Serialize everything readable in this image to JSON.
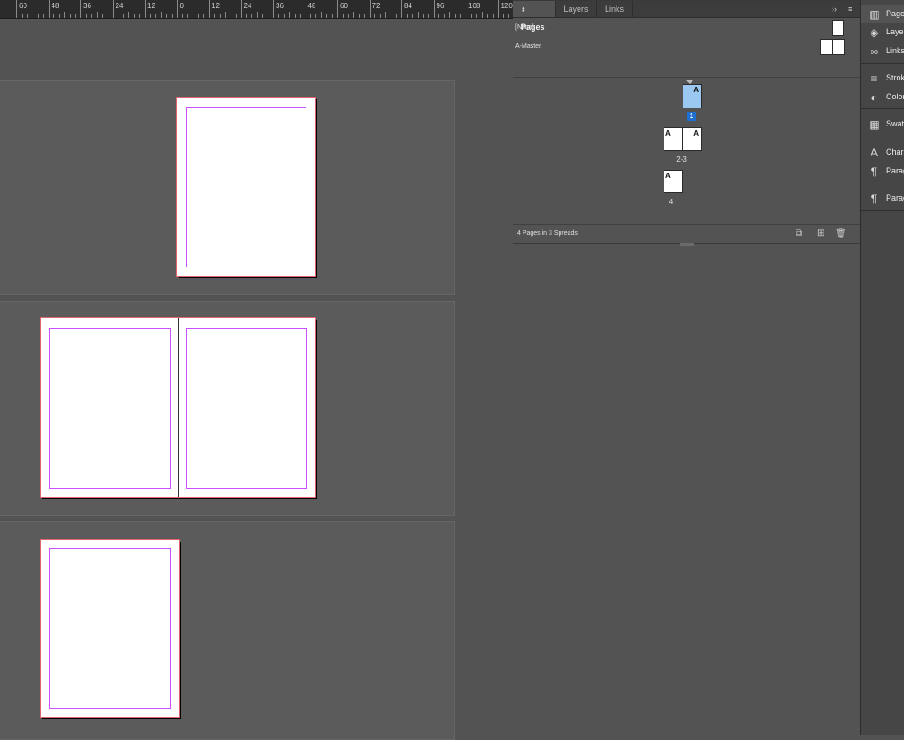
{
  "ruler": {
    "labels": [
      "60",
      "48",
      "36",
      "24",
      "12",
      "0",
      "12",
      "24",
      "36",
      "48",
      "60",
      "72",
      "84",
      "96",
      "108",
      "120"
    ]
  },
  "panel": {
    "tabs": [
      {
        "label": "Pages",
        "active": true
      },
      {
        "label": "Layers",
        "active": false
      },
      {
        "label": "Links",
        "active": false
      }
    ],
    "overflow_label": "››",
    "menu_label": "≡",
    "masters": [
      {
        "label": "[None]"
      },
      {
        "label": "A-Master"
      }
    ],
    "thumbnails": [
      {
        "letters": [
          "A"
        ],
        "number": "1",
        "selected": true
      },
      {
        "letters": [
          "A",
          "A"
        ],
        "number": "2-3",
        "selected": false
      },
      {
        "letters": [
          "A"
        ],
        "number": "4",
        "selected": false
      }
    ],
    "status": "4 Pages in 3 Spreads"
  },
  "dock": {
    "items": [
      {
        "label": "Pages",
        "icon": "pages-icon",
        "glyph": "▥"
      },
      {
        "label": "Layers",
        "icon": "layers-icon",
        "glyph": "◈"
      },
      {
        "label": "Links",
        "icon": "links-icon",
        "glyph": "∞"
      },
      {
        "label": "Stroke",
        "icon": "stroke-icon",
        "glyph": "≡"
      },
      {
        "label": "Color",
        "icon": "color-icon",
        "glyph": "◐"
      },
      {
        "label": "Swatches",
        "icon": "swatches-icon",
        "glyph": "▦"
      },
      {
        "label": "Character",
        "icon": "character-icon",
        "glyph": "A"
      },
      {
        "label": "Paragraph Styles",
        "icon": "paragraph-styles-icon",
        "glyph": "¶"
      },
      {
        "label": "Paragraph",
        "icon": "paragraph-icon",
        "glyph": "¶"
      }
    ]
  },
  "colors": {
    "margin_guide": "#c94fff",
    "page_bleed": "#e0636e",
    "selected_thumb": "#9bc8f0",
    "page_badge": "#1e6fd0"
  }
}
